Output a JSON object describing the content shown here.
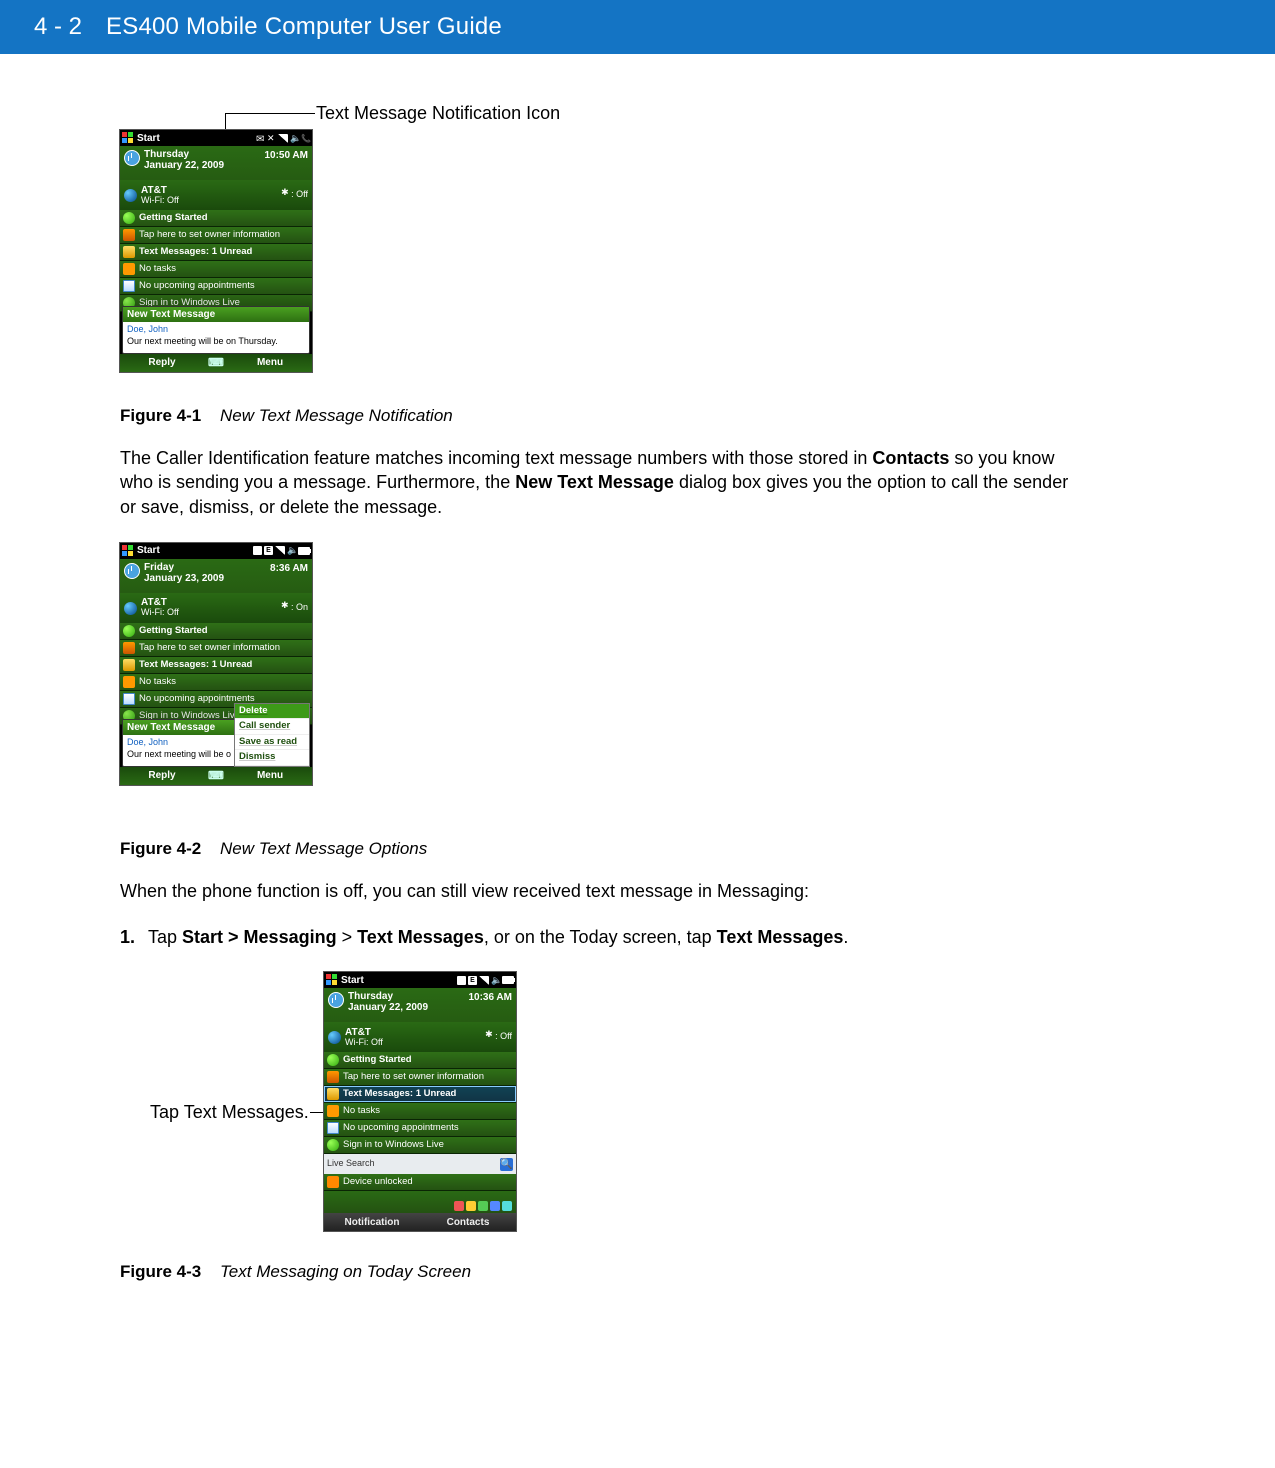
{
  "header": {
    "page_num": "4 - 2",
    "title": "ES400 Mobile Computer User Guide"
  },
  "callout_top": "Text Message Notification Icon",
  "callout_left": "Tap Text Messages.",
  "fig1": {
    "label": "Figure 4-1",
    "title": "New Text Message Notification"
  },
  "fig2": {
    "label": "Figure 4-2",
    "title": "New Text Message Options"
  },
  "fig3": {
    "label": "Figure 4-3",
    "title": "Text Messaging on Today Screen"
  },
  "para1_a": "The Caller Identification feature matches incoming text message numbers with those stored in ",
  "para1_b": "Contacts",
  "para1_c": " so you know who is sending you a message. Furthermore, the ",
  "para1_d": "New Text Message",
  "para1_e": " dialog box gives you the option to call the sender or save, dismiss, or delete the message.",
  "para2": "When the phone function is off, you can still view received text message in Messaging:",
  "step1_a": "Tap ",
  "step1_b": "Start > Messaging",
  "step1_c": " > ",
  "step1_d": "Text Messages",
  "step1_e": ", or on the Today screen, tap ",
  "step1_f": "Text Messages",
  "step1_g": ".",
  "step1_num": "1.",
  "phone1": {
    "start": "Start",
    "day": "Thursday",
    "date": "January 22, 2009",
    "time": "10:50 AM",
    "carrier": "AT&T",
    "wifi": "Wi-Fi: Off",
    "bt": ": Off",
    "items": {
      "getting_started": "Getting Started",
      "owner": "Tap here to set owner information",
      "msgs": "Text Messages: 1 Unread",
      "tasks": "No tasks",
      "appts": "No upcoming appointments",
      "live": "Sign in to Windows Live"
    },
    "popup": {
      "header": "New Text Message",
      "from": "Doe, John",
      "body": "Our next meeting will be on Thursday."
    },
    "softkeys": {
      "left": "Reply",
      "right": "Menu"
    }
  },
  "phone2": {
    "start": "Start",
    "day": "Friday",
    "date": "January 23, 2009",
    "time": "8:36 AM",
    "carrier": "AT&T",
    "wifi": "Wi-Fi: Off",
    "bt": ": On",
    "items": {
      "getting_started": "Getting Started",
      "owner": "Tap here to set owner information",
      "msgs": "Text Messages: 1 Unread",
      "tasks": "No tasks",
      "appts": "No upcoming appointments",
      "live": "Sign in to Windows Live"
    },
    "popup": {
      "header": "New Text Message",
      "from": "Doe, John",
      "body": "Our next meeting will be o"
    },
    "menu": {
      "delete": "Delete",
      "call": "Call sender",
      "save": "Save as read",
      "dismiss": "Dismiss"
    },
    "softkeys": {
      "left": "Reply",
      "right": "Menu"
    }
  },
  "phone3": {
    "start": "Start",
    "day": "Thursday",
    "date": "January 22, 2009",
    "time": "10:36 AM",
    "carrier": "AT&T",
    "wifi": "Wi-Fi: Off",
    "bt": ": Off",
    "items": {
      "getting_started": "Getting Started",
      "owner": "Tap here to set owner information",
      "msgs": "Text Messages: 1 Unread",
      "tasks": "No tasks",
      "appts": "No upcoming appointments",
      "live": "Sign in to Windows Live",
      "livesearch": "Live Search",
      "unlocked": "Device unlocked"
    },
    "softkeys": {
      "left": "Notification",
      "right": "Contacts"
    }
  }
}
